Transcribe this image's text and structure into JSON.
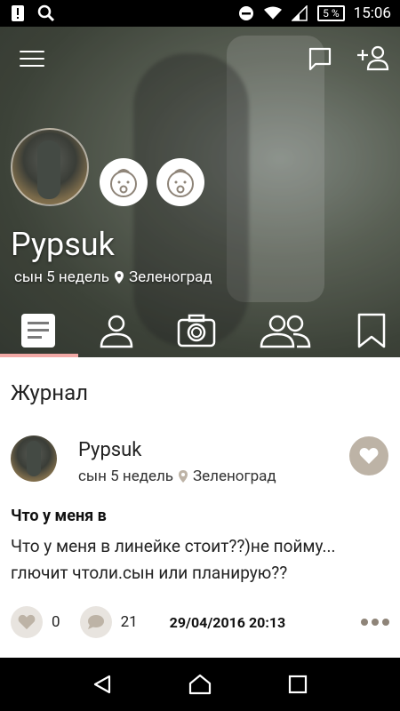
{
  "status_bar": {
    "time": "15:06",
    "battery": "5 %",
    "icons": [
      "alert-icon",
      "search-icon",
      "do-not-disturb-icon",
      "wifi-icon",
      "signal-icon",
      "battery-icon"
    ]
  },
  "header": {
    "menu_icon": "menu-icon",
    "message_icon": "message-icon",
    "add_friend_icon": "add-user-icon",
    "profile_name": "Pypsuk",
    "child_label": "сын 5 недель",
    "location": "Зеленоград",
    "tabs": [
      {
        "name": "journal",
        "icon": "journal-icon",
        "active": true
      },
      {
        "name": "profile",
        "icon": "person-icon",
        "active": false
      },
      {
        "name": "photos",
        "icon": "camera-icon",
        "active": false
      },
      {
        "name": "friends",
        "icon": "group-icon",
        "active": false
      },
      {
        "name": "bookmarks",
        "icon": "bookmark-icon",
        "active": false
      }
    ]
  },
  "main": {
    "section_title": "Журнал",
    "post": {
      "author": "Pypsuk",
      "child_label": "сын 5 недель",
      "location": "Зеленоград",
      "title": "Что у меня в",
      "body": "Что у меня в линейке стоит??)не пойму... глючит чтоли.сын или планирую??",
      "likes": "0",
      "comments": "21",
      "date": "29/04/2016 20:13"
    }
  },
  "colors": {
    "tab_indicator": "#f2a9a6",
    "like_button": "#bdb3a6",
    "action_circle": "#e8e4df"
  }
}
